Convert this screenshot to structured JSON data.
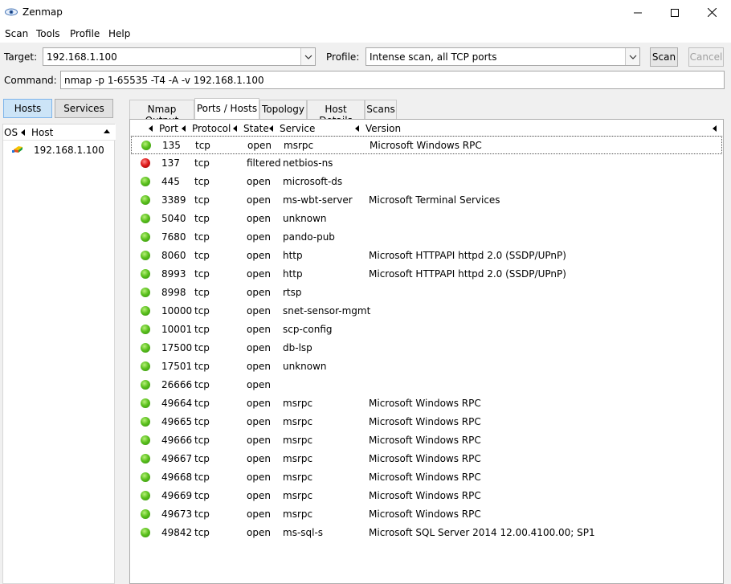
{
  "window": {
    "title": "Zenmap",
    "icon": "zenmap-eye-icon",
    "controls": [
      "minimize",
      "maximize",
      "close"
    ]
  },
  "menu": {
    "items": [
      "Scan",
      "Tools",
      "Profile",
      "Help"
    ]
  },
  "toolbar": {
    "target_label": "Target:",
    "target_value": "192.168.1.100",
    "profile_label": "Profile:",
    "profile_value": "Intense scan, all TCP ports",
    "scan_button": "Scan",
    "cancel_button": "Cancel",
    "command_label": "Command:",
    "command_value": "nmap -p 1-65535 -T4 -A -v 192.168.1.100"
  },
  "sidebar": {
    "hosts_button": "Hosts",
    "services_button": "Services",
    "col_os": "OS",
    "col_host": "Host",
    "hosts": [
      {
        "os_icon": "windows-os-icon",
        "address": "192.168.1.100"
      }
    ]
  },
  "tabs": [
    "Nmap Output",
    "Ports / Hosts",
    "Topology",
    "Host Details",
    "Scans"
  ],
  "active_tab": "Ports / Hosts",
  "ports_table": {
    "columns": [
      "Port",
      "Protocol",
      "State",
      "Service",
      "Version"
    ],
    "status_colors": {
      "open": "#5cc11e",
      "filtered": "#e01c1c"
    },
    "rows": [
      {
        "port": "135",
        "protocol": "tcp",
        "state": "open",
        "service": "msrpc",
        "version": "Microsoft Windows RPC"
      },
      {
        "port": "137",
        "protocol": "tcp",
        "state": "filtered",
        "service": "netbios-ns",
        "version": ""
      },
      {
        "port": "445",
        "protocol": "tcp",
        "state": "open",
        "service": "microsoft-ds",
        "version": ""
      },
      {
        "port": "3389",
        "protocol": "tcp",
        "state": "open",
        "service": "ms-wbt-server",
        "version": "Microsoft Terminal Services"
      },
      {
        "port": "5040",
        "protocol": "tcp",
        "state": "open",
        "service": "unknown",
        "version": ""
      },
      {
        "port": "7680",
        "protocol": "tcp",
        "state": "open",
        "service": "pando-pub",
        "version": ""
      },
      {
        "port": "8060",
        "protocol": "tcp",
        "state": "open",
        "service": "http",
        "version": "Microsoft HTTPAPI httpd 2.0 (SSDP/UPnP)"
      },
      {
        "port": "8993",
        "protocol": "tcp",
        "state": "open",
        "service": "http",
        "version": "Microsoft HTTPAPI httpd 2.0 (SSDP/UPnP)"
      },
      {
        "port": "8998",
        "protocol": "tcp",
        "state": "open",
        "service": "rtsp",
        "version": ""
      },
      {
        "port": "10000",
        "protocol": "tcp",
        "state": "open",
        "service": "snet-sensor-mgmt",
        "version": ""
      },
      {
        "port": "10001",
        "protocol": "tcp",
        "state": "open",
        "service": "scp-config",
        "version": ""
      },
      {
        "port": "17500",
        "protocol": "tcp",
        "state": "open",
        "service": "db-lsp",
        "version": ""
      },
      {
        "port": "17501",
        "protocol": "tcp",
        "state": "open",
        "service": "unknown",
        "version": ""
      },
      {
        "port": "26666",
        "protocol": "tcp",
        "state": "open",
        "service": "",
        "version": ""
      },
      {
        "port": "49664",
        "protocol": "tcp",
        "state": "open",
        "service": "msrpc",
        "version": "Microsoft Windows RPC"
      },
      {
        "port": "49665",
        "protocol": "tcp",
        "state": "open",
        "service": "msrpc",
        "version": "Microsoft Windows RPC"
      },
      {
        "port": "49666",
        "protocol": "tcp",
        "state": "open",
        "service": "msrpc",
        "version": "Microsoft Windows RPC"
      },
      {
        "port": "49667",
        "protocol": "tcp",
        "state": "open",
        "service": "msrpc",
        "version": "Microsoft Windows RPC"
      },
      {
        "port": "49668",
        "protocol": "tcp",
        "state": "open",
        "service": "msrpc",
        "version": "Microsoft Windows RPC"
      },
      {
        "port": "49669",
        "protocol": "tcp",
        "state": "open",
        "service": "msrpc",
        "version": "Microsoft Windows RPC"
      },
      {
        "port": "49673",
        "protocol": "tcp",
        "state": "open",
        "service": "msrpc",
        "version": "Microsoft Windows RPC"
      },
      {
        "port": "49842",
        "protocol": "tcp",
        "state": "open",
        "service": "ms-sql-s",
        "version": "Microsoft SQL Server 2014 12.00.4100.00; SP1"
      }
    ]
  }
}
